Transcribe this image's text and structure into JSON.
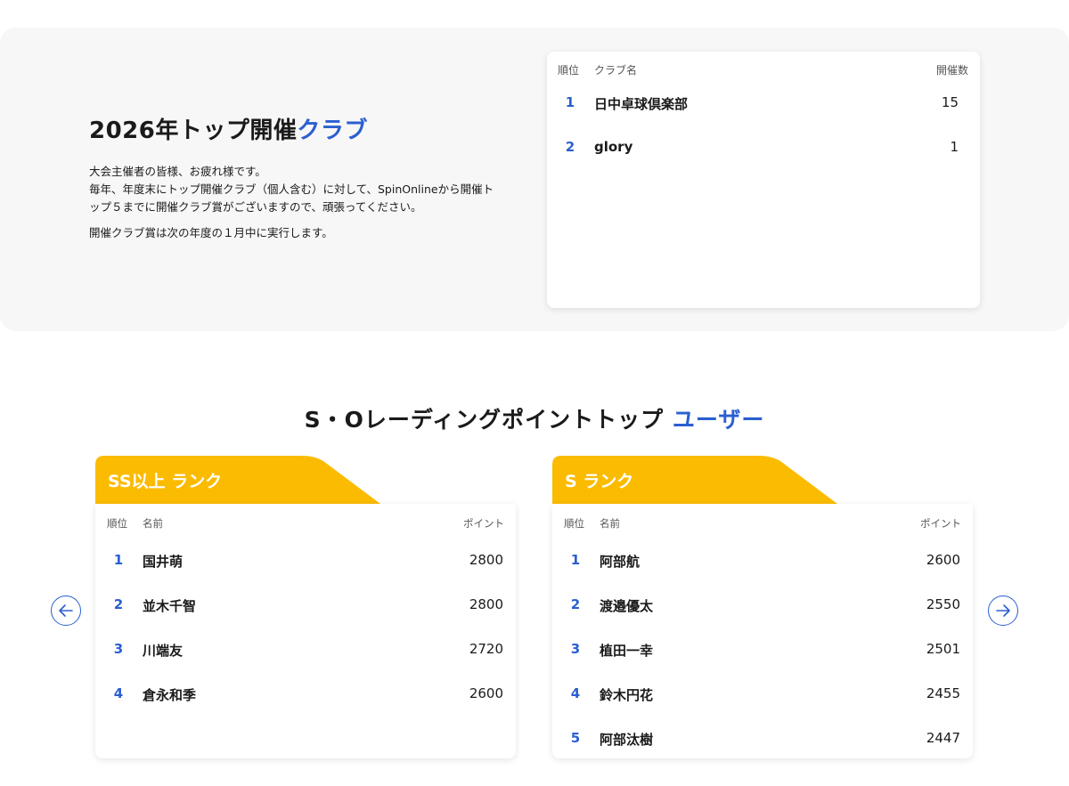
{
  "club_section": {
    "title_main": "2026年トップ開催",
    "title_accent": "クラブ",
    "desc_lines": [
      "大会主催者の皆様、お疲れ様です。",
      "毎年、年度末にトップ開催クラブ（個人含む）に対して、SpinOnlineから開催ト",
      "ップ５までに開催クラブ賞がございますので、頑張ってください。"
    ],
    "note": "開催クラブ賞は次の年度の１月中に実行します。",
    "table": {
      "headers": {
        "rank": "順位",
        "name": "クラブ名",
        "count": "開催数"
      },
      "rows": [
        {
          "rank": "1",
          "name": "日中卓球倶楽部",
          "count": "15"
        },
        {
          "rank": "2",
          "name": "glory",
          "count": "1"
        }
      ]
    }
  },
  "rating_section": {
    "title_main": "S・Oレーディングポイントトップ ",
    "title_accent": "ユーザー",
    "colors": {
      "accent": "#2a5fd0",
      "tab": "#fbbb00"
    },
    "icons": {
      "prev": "arrow-left-icon",
      "next": "arrow-right-icon"
    },
    "panels": [
      {
        "label": "SS以上 ランク",
        "headers": {
          "rank": "順位",
          "name": "名前",
          "points": "ポイント"
        },
        "rows": [
          {
            "rank": "1",
            "name": "国井萌",
            "points": "2800"
          },
          {
            "rank": "2",
            "name": "並木千智",
            "points": "2800"
          },
          {
            "rank": "3",
            "name": "川端友",
            "points": "2720"
          },
          {
            "rank": "4",
            "name": "倉永和季",
            "points": "2600"
          }
        ]
      },
      {
        "label": "S ランク",
        "headers": {
          "rank": "順位",
          "name": "名前",
          "points": "ポイント"
        },
        "rows": [
          {
            "rank": "1",
            "name": "阿部航",
            "points": "2600"
          },
          {
            "rank": "2",
            "name": "渡邉優太",
            "points": "2550"
          },
          {
            "rank": "3",
            "name": "植田一幸",
            "points": "2501"
          },
          {
            "rank": "4",
            "name": "鈴木円花",
            "points": "2455"
          },
          {
            "rank": "5",
            "name": "阿部汰樹",
            "points": "2447"
          }
        ]
      }
    ]
  }
}
